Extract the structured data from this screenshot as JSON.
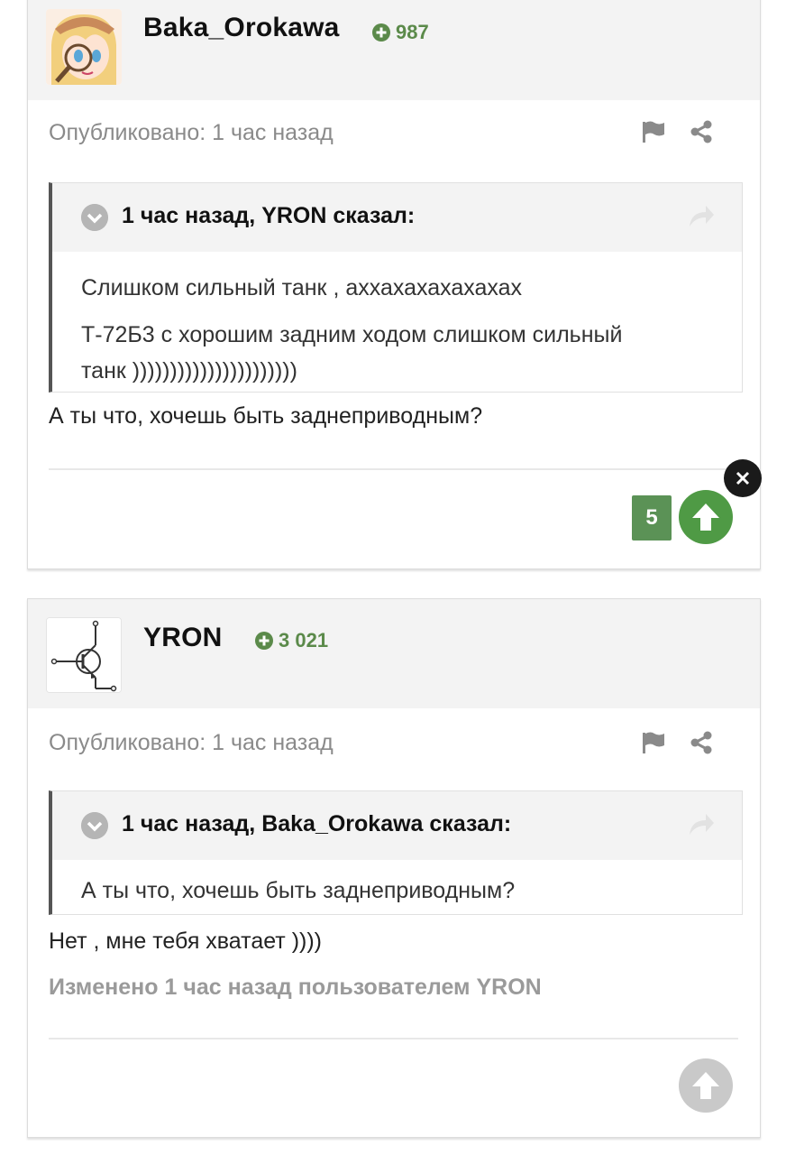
{
  "posts": [
    {
      "author": "Baka_Orokawa",
      "reputation": "987",
      "published": "Опубликовано: 1 час назад",
      "quote": {
        "title": "1 час назад, YRON сказал:",
        "lines": [
          "Слишком сильный танк , аххахахахахахах",
          "Т-72Б3 с хорошим задним ходом слишком сильный",
          "танк ))))))))))))))))))))))"
        ]
      },
      "text": "А ты что, хочешь быть заднеприводным?",
      "votes": "5"
    },
    {
      "author": "YRON",
      "reputation": "3 021",
      "published": "Опубликовано: 1 час назад",
      "quote": {
        "title": "1 час назад, Baka_Orokawa сказал:",
        "lines": [
          "А ты что, хочешь быть заднеприводным?"
        ]
      },
      "text": "Нет , мне тебя хватает ))))",
      "edited": "Изменено 1 час назад пользователем YRON"
    }
  ],
  "colors": {
    "reputation": "#5b8a4a",
    "vote_active": "#4f9a45",
    "vote_count_bg": "#5b9256",
    "vote_inactive": "#c9c9c9"
  },
  "icons": {
    "reputation": "plus-circle-icon",
    "report": "flag-icon",
    "share": "share-icon",
    "quote_toggle": "chevron-down-icon",
    "quote_link": "forward-arrow-icon",
    "upvote": "arrow-up-icon",
    "dismiss": "close-icon"
  }
}
